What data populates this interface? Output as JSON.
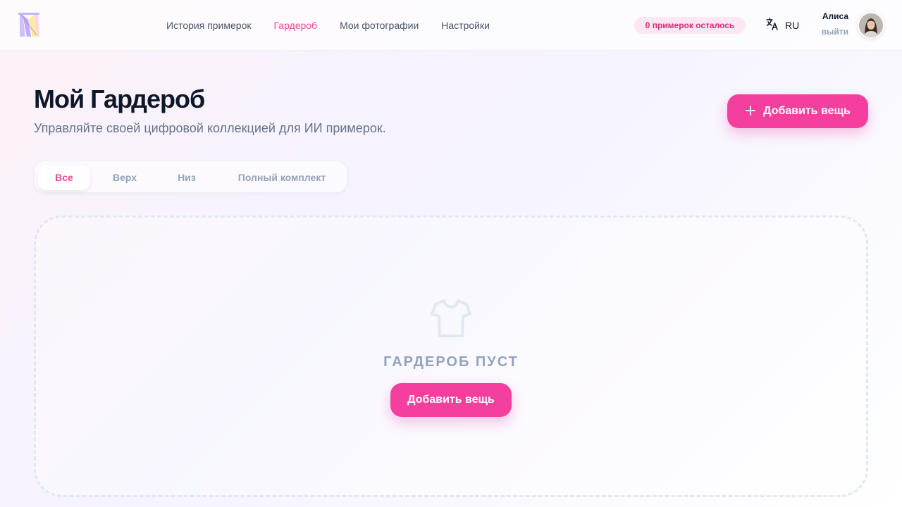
{
  "header": {
    "logo_icon": "wardrobe-logo",
    "nav": [
      {
        "label": "История примерок",
        "active": false
      },
      {
        "label": "Гардероб",
        "active": true
      },
      {
        "label": "Мои фотографии",
        "active": false
      },
      {
        "label": "Настройки",
        "active": false
      }
    ],
    "credits_badge": "0 примерок осталось",
    "language": {
      "icon": "translate-icon",
      "label": "RU"
    },
    "user": {
      "name": "Алиса",
      "logout_label": "выйти",
      "avatar_icon": "user-avatar"
    }
  },
  "page": {
    "title": "Мой Гардероб",
    "subtitle": "Управляйте своей цифровой коллекцией для ИИ примерок.",
    "add_button_label": "Добавить вещь"
  },
  "tabs": [
    {
      "label": "Все",
      "active": true
    },
    {
      "label": "Верх",
      "active": false
    },
    {
      "label": "Низ",
      "active": false
    },
    {
      "label": "Полный комплект",
      "active": false
    }
  ],
  "empty_state": {
    "icon": "tshirt-icon",
    "text": "ГАРДЕРОБ ПУСТ",
    "button_label": "Добавить вещь"
  },
  "colors": {
    "accent": "#f43f9e",
    "accent_text": "#ec4899",
    "badge_bg": "#fce7f3",
    "muted": "#94a3b8"
  }
}
